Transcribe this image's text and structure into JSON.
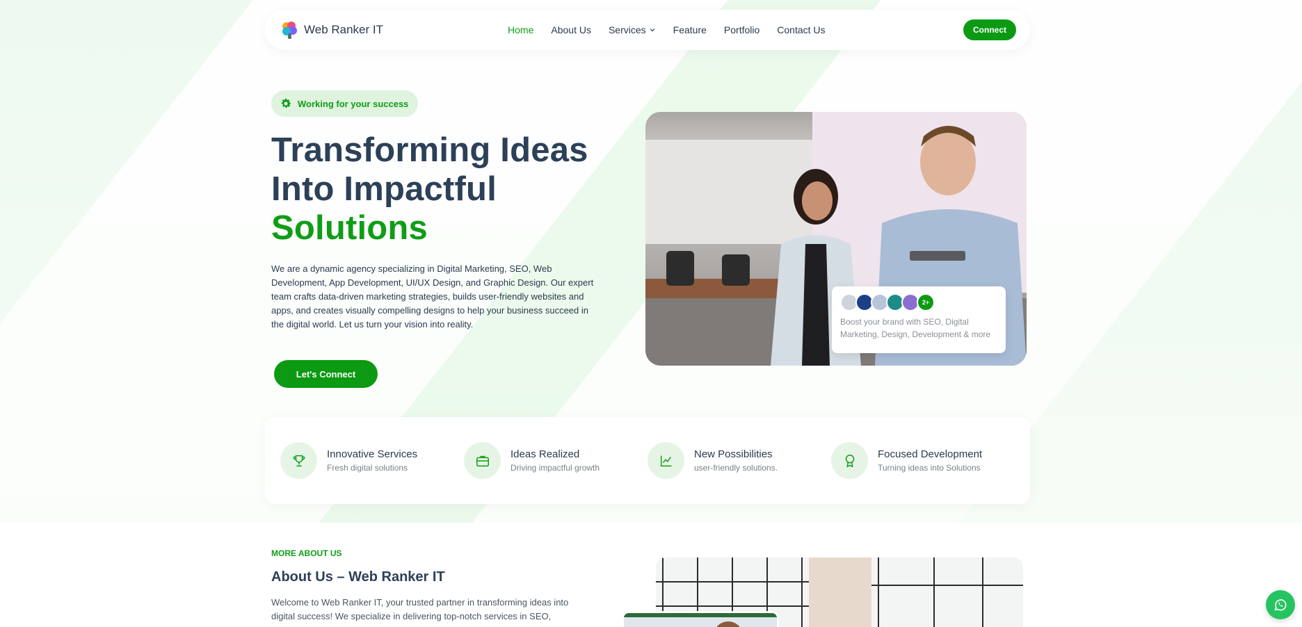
{
  "brand": {
    "name": "Web Ranker IT"
  },
  "nav": {
    "items": [
      {
        "label": "Home"
      },
      {
        "label": "About Us"
      },
      {
        "label": "Services"
      },
      {
        "label": "Feature"
      },
      {
        "label": "Portfolio"
      },
      {
        "label": "Contact Us"
      }
    ],
    "active": "Home",
    "connect_label": "Connect"
  },
  "hero": {
    "badge": "Working for your success",
    "title_line1": "Transforming Ideas",
    "title_line2": "Into Impactful",
    "title_highlight": "Solutions",
    "description": "We are a dynamic agency specializing in Digital Marketing, SEO, Web Development, App Development, UI/UX Design, and Graphic Design. Our expert team crafts data-driven marketing strategies, builds user-friendly websites and apps, and creates visually compelling designs to help your business succeed in the digital world. Let us turn your vision into reality.",
    "cta_label": "Let's Connect",
    "card": {
      "more_badge": "2+",
      "text": "Boost your brand with SEO, Digital Marketing, Design, Development & more"
    }
  },
  "features": [
    {
      "title": "Innovative Services",
      "subtitle": "Fresh digital solutions",
      "icon": "trophy-icon"
    },
    {
      "title": "Ideas Realized",
      "subtitle": "Driving impactful growth",
      "icon": "briefcase-icon"
    },
    {
      "title": "New Possibilities",
      "subtitle": "user-friendly solutions.",
      "icon": "chart-line-icon"
    },
    {
      "title": "Focused Development",
      "subtitle": "Turning ideas into Solutions",
      "icon": "award-icon"
    }
  ],
  "about": {
    "kicker": "MORE ABOUT US",
    "title": "About Us – Web Ranker IT",
    "text": "Welcome to Web Ranker IT, your trusted partner in transforming ideas into digital success! We specialize in delivering top-notch services in SEO,"
  },
  "colors": {
    "accent": "#0b9a12",
    "heading": "#2c4058",
    "whatsapp": "#25c460"
  }
}
